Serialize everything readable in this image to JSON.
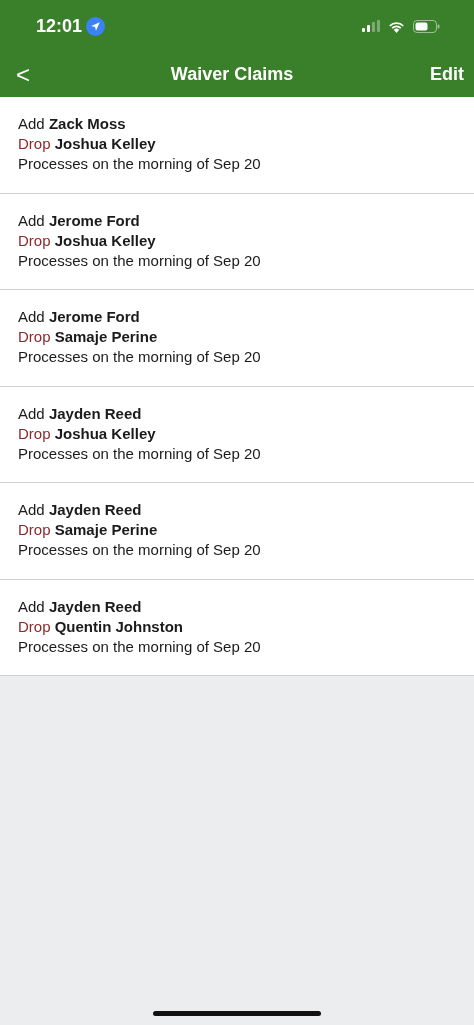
{
  "status_bar": {
    "time": "12:01"
  },
  "nav": {
    "back": "<",
    "title": "Waiver Claims",
    "action": "Edit"
  },
  "claims": [
    {
      "add_label": "Add",
      "add_player": "Zack Moss",
      "drop_label": "Drop",
      "drop_player": "Joshua Kelley",
      "note": "Processes on the morning of Sep 20"
    },
    {
      "add_label": "Add",
      "add_player": "Jerome Ford",
      "drop_label": "Drop",
      "drop_player": "Joshua Kelley",
      "note": "Processes on the morning of Sep 20"
    },
    {
      "add_label": "Add",
      "add_player": "Jerome Ford",
      "drop_label": "Drop",
      "drop_player": "Samaje Perine",
      "note": "Processes on the morning of Sep 20"
    },
    {
      "add_label": "Add",
      "add_player": "Jayden Reed",
      "drop_label": "Drop",
      "drop_player": "Joshua Kelley",
      "note": "Processes on the morning of Sep 20"
    },
    {
      "add_label": "Add",
      "add_player": "Jayden Reed",
      "drop_label": "Drop",
      "drop_player": "Samaje Perine",
      "note": "Processes on the morning of Sep 20"
    },
    {
      "add_label": "Add",
      "add_player": "Jayden Reed",
      "drop_label": "Drop",
      "drop_player": "Quentin Johnston",
      "note": "Processes on the morning of Sep 20"
    }
  ]
}
